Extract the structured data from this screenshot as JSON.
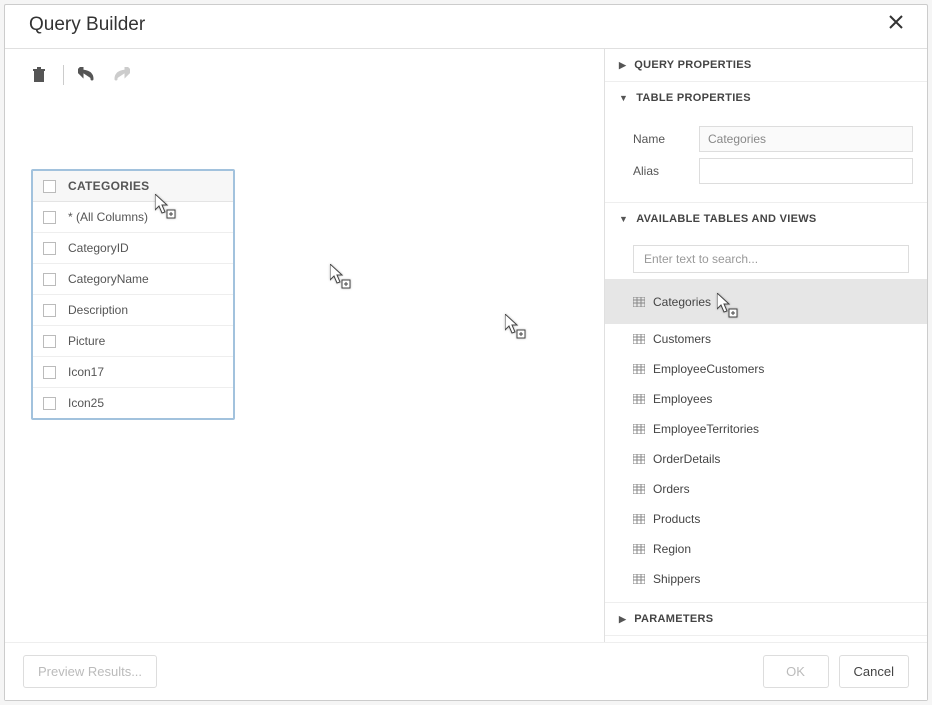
{
  "dialog": {
    "title": "Query Builder"
  },
  "table_card": {
    "title": "CATEGORIES",
    "columns": [
      "* (All Columns)",
      "CategoryID",
      "CategoryName",
      "Description",
      "Picture",
      "Icon17",
      "Icon25"
    ]
  },
  "panel": {
    "query_properties": "QUERY PROPERTIES",
    "table_properties": "TABLE PROPERTIES",
    "name_label": "Name",
    "alias_label": "Alias",
    "name_value": "Categories",
    "alias_value": "",
    "available_tables": "AVAILABLE TABLES AND VIEWS",
    "search_placeholder": "Enter text to search...",
    "tables": [
      "Categories",
      "Customers",
      "EmployeeCustomers",
      "Employees",
      "EmployeeTerritories",
      "OrderDetails",
      "Orders",
      "Products",
      "Region",
      "Shippers"
    ],
    "parameters": "PARAMETERS"
  },
  "footer": {
    "preview": "Preview Results...",
    "ok": "OK",
    "cancel": "Cancel"
  }
}
